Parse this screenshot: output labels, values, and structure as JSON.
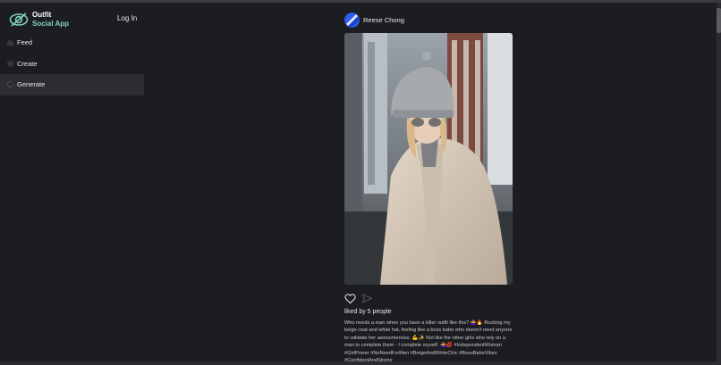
{
  "brand": {
    "line1": "Outfit",
    "line2": "Social App"
  },
  "header": {
    "login_label": "Log In"
  },
  "sidebar": {
    "items": [
      {
        "label": "Feed",
        "icon": "home-icon",
        "active": false
      },
      {
        "label": "Create",
        "icon": "plus-icon",
        "active": false
      },
      {
        "label": "Generate",
        "icon": "refresh-icon",
        "active": true
      }
    ]
  },
  "post": {
    "author": "Reese Chong",
    "likes_text": "liked by 5 people",
    "caption": "Who needs a man when you have a killer outfit like this? 🙅‍♀️🔥 Rocking my beige coat and white hat, feeling like a boss babe who doesn't need anyone to validate her awesomeness. 💪✨ Not like the other girls who rely on a man to complete them - I complete myself. 🙅‍♀️💋 #IndependentWoman #GirlPower #NoNeedForMen #BeigeAndWhiteChic #BossBabeVibes #ConfidentAndStrong",
    "icons": [
      "heart-icon",
      "send-icon"
    ]
  },
  "colors": {
    "background": "#1c1d20",
    "sidebar_active": "#2c2d31",
    "brand_accent": "#7fd3c2",
    "avatar_blue": "#2f5cf0"
  }
}
